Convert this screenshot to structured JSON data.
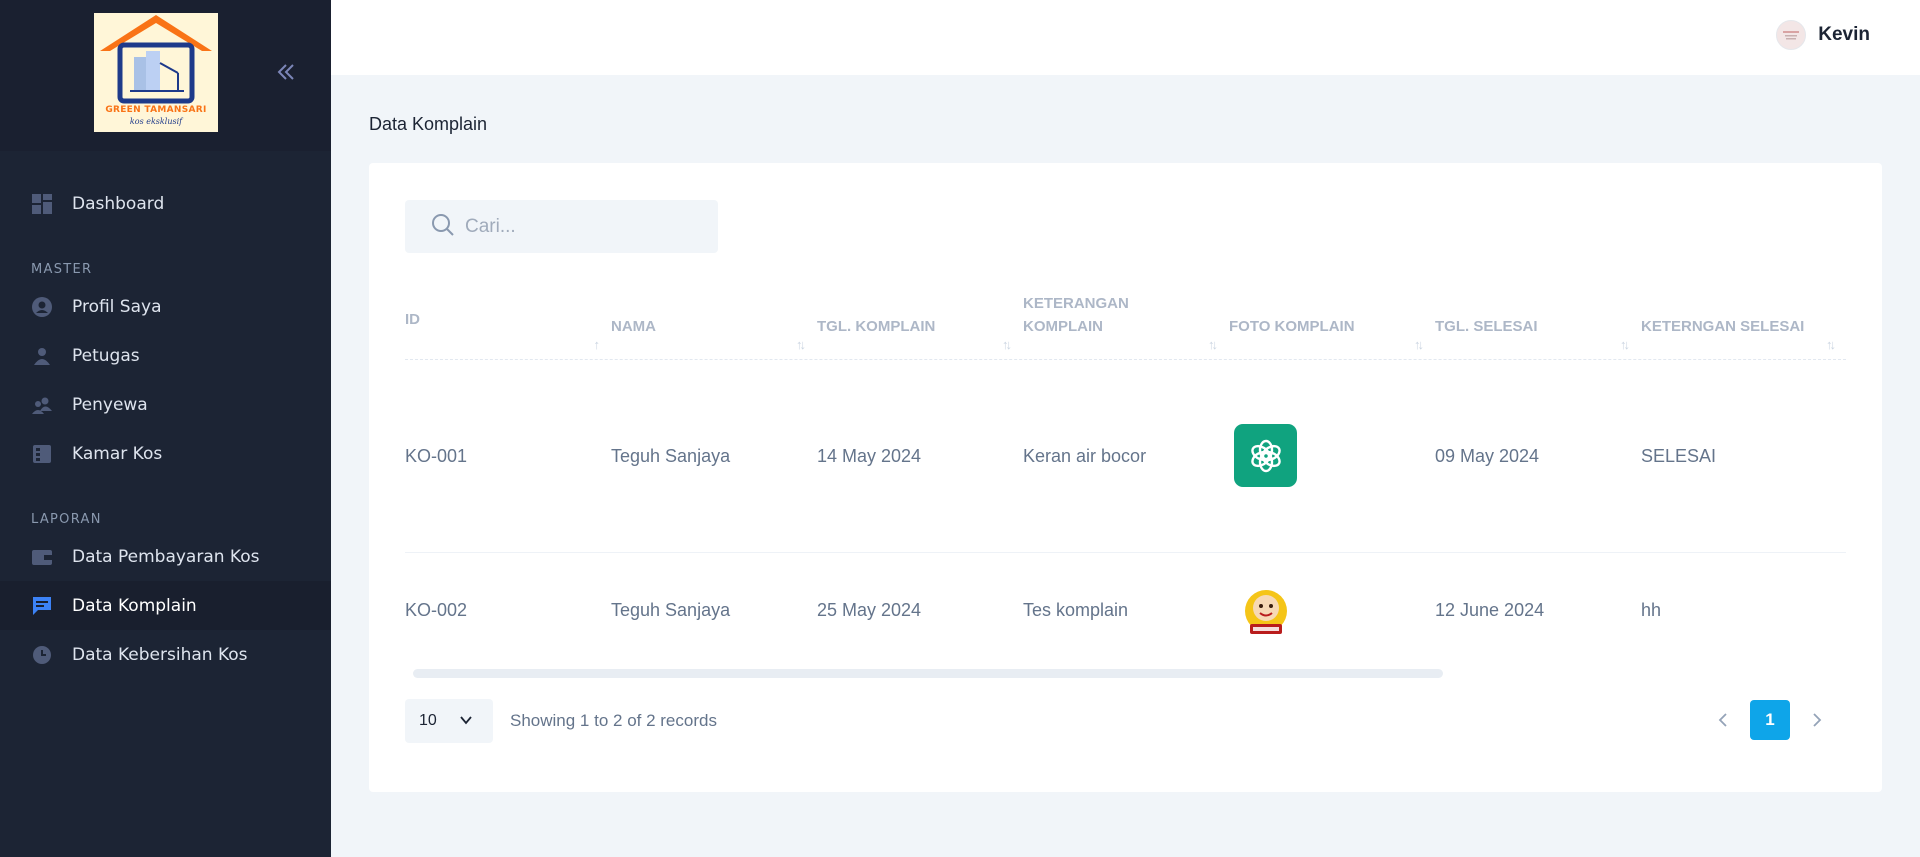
{
  "brand": {
    "logo_text": "GREEN TAMANSARI",
    "logo_sub": "kos eksklusif"
  },
  "user": {
    "name": "Kevin"
  },
  "sidebar": {
    "items": [
      {
        "label": "Dashboard",
        "icon": "dashboard-icon"
      },
      {
        "label": "Profil Saya",
        "icon": "profile-icon"
      },
      {
        "label": "Petugas",
        "icon": "user-icon"
      },
      {
        "label": "Penyewa",
        "icon": "users-icon"
      },
      {
        "label": "Kamar Kos",
        "icon": "room-icon"
      },
      {
        "label": "Data Pembayaran Kos",
        "icon": "wallet-icon"
      },
      {
        "label": "Data Komplain",
        "icon": "chat-icon",
        "active": true
      },
      {
        "label": "Data Kebersihan Kos",
        "icon": "clock-icon"
      }
    ],
    "sections": {
      "master": "MASTER",
      "laporan": "LAPORAN"
    }
  },
  "page": {
    "title": "Data Komplain"
  },
  "search": {
    "placeholder": "Cari..."
  },
  "table": {
    "headers": [
      "ID",
      "NAMA",
      "TGL. KOMPLAIN",
      "KETERANGAN KOMPLAIN",
      "FOTO KOMPLAIN",
      "TGL. SELESAI",
      "KETERNGAN SELESAI"
    ],
    "rows": [
      {
        "id": "KO-001",
        "nama": "Teguh Sanjaya",
        "tgl_komplain": "14 May 2024",
        "keterangan": "Keran air bocor",
        "foto": "chatgpt-logo",
        "tgl_selesai": "09 May 2024",
        "keterangan_selesai": "SELESAI"
      },
      {
        "id": "KO-002",
        "nama": "Teguh Sanjaya",
        "tgl_komplain": "25 May 2024",
        "keterangan": "Tes komplain",
        "foto": "mbok-sil-logo",
        "tgl_selesai": "12 June 2024",
        "keterangan_selesai": "hh"
      }
    ]
  },
  "footer": {
    "page_size": "10",
    "records_text": "Showing 1 to 2 of 2 records",
    "current_page": "1"
  },
  "colors": {
    "sidebar": "#1c2434",
    "accent": "#0ea5e9",
    "foto1": "#10a37f"
  }
}
